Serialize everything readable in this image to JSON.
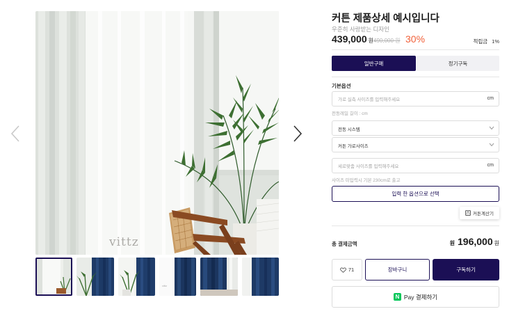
{
  "gallery": {
    "watermark": "vittz",
    "thumbnails": [
      "thumb-1",
      "thumb-2",
      "thumb-3",
      "thumb-4",
      "thumb-5",
      "thumb-6"
    ],
    "active_thumb_index": 0
  },
  "product": {
    "title": "커튼 제품상세 예시입니다",
    "subtitle": "우준히 사랑받는 디자인",
    "price": "439,000",
    "price_unit": "원",
    "original_price": "490,000 원",
    "discount": "30%",
    "points_label": "적립금",
    "points_value": "1%"
  },
  "tabs": [
    {
      "label": "일반구매",
      "active": true
    },
    {
      "label": "정기구독",
      "active": false
    }
  ],
  "options": {
    "section_label": "기본옵션",
    "width_input": {
      "placeholder": "가로 실측 사이즈를 입력해주세요",
      "value": "",
      "unit": "cm"
    },
    "width_hint": "전동레일 길이 : cm",
    "motor_select": "전동 시스템",
    "size_select": "커튼 가로사이즈",
    "height_input": {
      "placeholder": "세로맞춤 사이즈를 입력해주세요",
      "value": "",
      "unit": "cm"
    },
    "height_hint": "사이즈 미입력시 기본 230cm로 출고",
    "apply_button": "입력 한 옵션으로 선택",
    "calc_button": "커튼계산기"
  },
  "total": {
    "label": "총 결제금액",
    "currency": "원",
    "amount": "196,000",
    "unit": "원"
  },
  "actions": {
    "like_count": "71",
    "cart_button": "장바구니",
    "buy_button": "구독하기",
    "npay_logo": "N",
    "npay_button": "Pay 결제하기"
  },
  "colors": {
    "accent": "#1b0f55",
    "discount": "#f1613a",
    "npay": "#03c75a"
  }
}
